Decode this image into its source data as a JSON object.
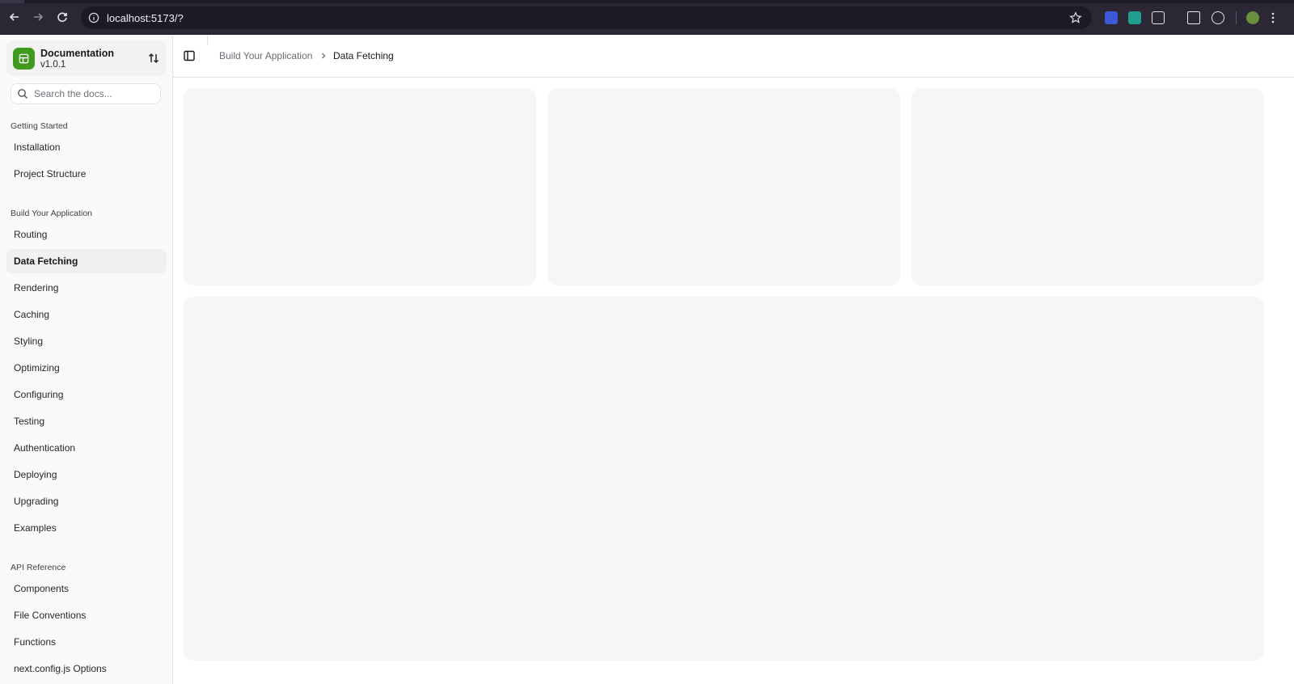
{
  "browser": {
    "url": "localhost:5173/?",
    "icons": [
      "back-icon",
      "forward-icon",
      "reload-icon",
      "site-info-icon",
      "bookmark-star-icon",
      "extension-shield-icon",
      "extension-teal-icon",
      "extensions-puzzle-icon",
      "translate-icon",
      "screenshot-icon",
      "profile-avatar-icon",
      "more-menu-icon"
    ]
  },
  "team": {
    "name": "Documentation",
    "version": "v1.0.1"
  },
  "search": {
    "placeholder": "Search the docs..."
  },
  "sidebar": {
    "groups": [
      {
        "label": "Getting Started",
        "items": [
          {
            "label": "Installation"
          },
          {
            "label": "Project Structure"
          }
        ]
      },
      {
        "label": "Build Your Application",
        "items": [
          {
            "label": "Routing"
          },
          {
            "label": "Data Fetching",
            "active": true
          },
          {
            "label": "Rendering"
          },
          {
            "label": "Caching"
          },
          {
            "label": "Styling"
          },
          {
            "label": "Optimizing"
          },
          {
            "label": "Configuring"
          },
          {
            "label": "Testing"
          },
          {
            "label": "Authentication"
          },
          {
            "label": "Deploying"
          },
          {
            "label": "Upgrading"
          },
          {
            "label": "Examples"
          }
        ]
      },
      {
        "label": "API Reference",
        "items": [
          {
            "label": "Components"
          },
          {
            "label": "File Conventions"
          },
          {
            "label": "Functions"
          },
          {
            "label": "next.config.js Options"
          }
        ]
      }
    ]
  },
  "breadcrumb": {
    "parent": "Build Your Application",
    "current": "Data Fetching"
  },
  "colors": {
    "brand": "#3f9a1e",
    "chrome": "#2b2734",
    "card": "#f6f6f7"
  }
}
